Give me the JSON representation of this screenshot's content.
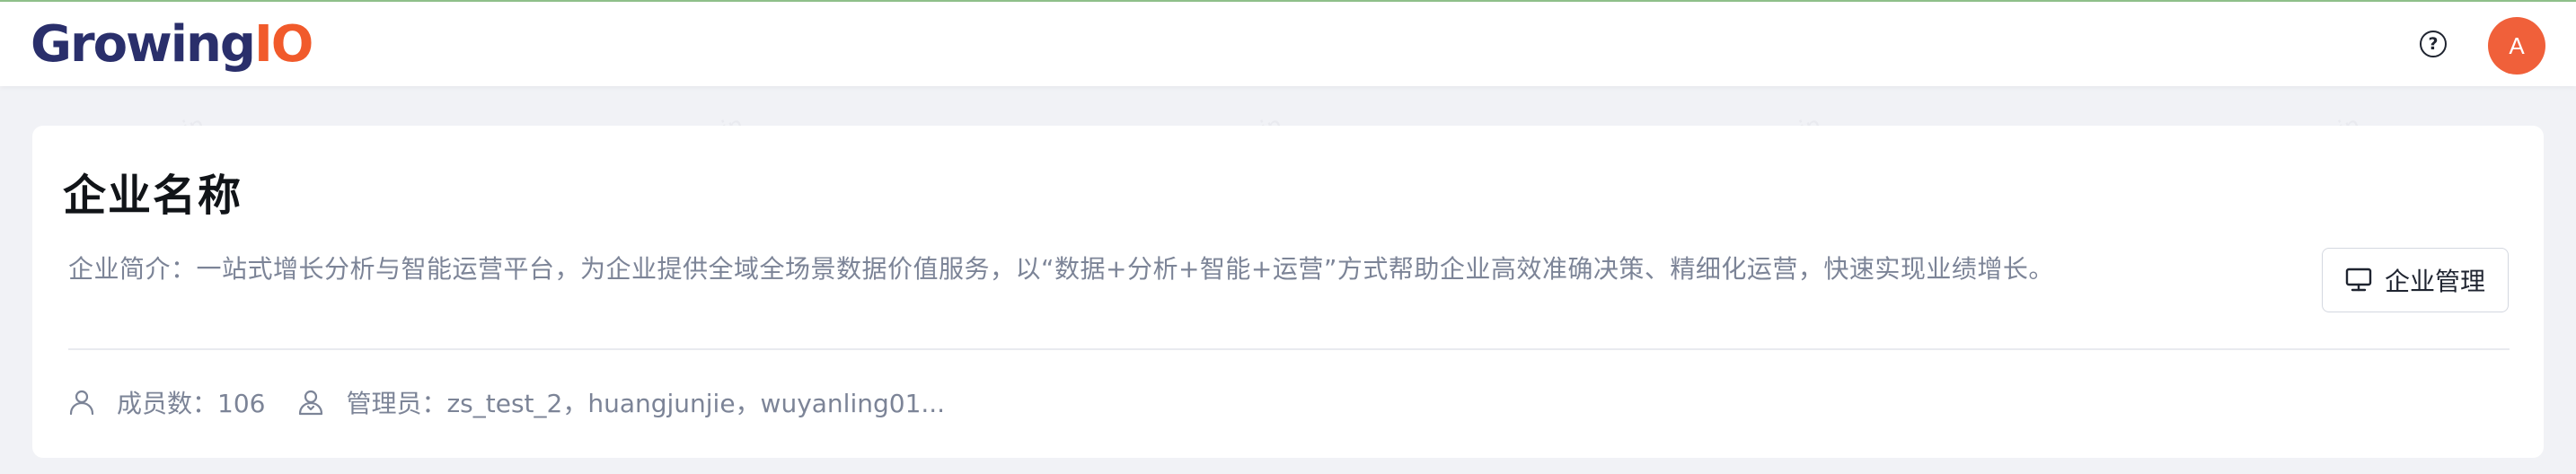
{
  "header": {
    "logo_main": "Growing",
    "logo_accent": "IO",
    "help_icon": "?",
    "avatar_initial": "A"
  },
  "watermark": "admin admin",
  "company": {
    "name": "企业名称",
    "description": "企业简介：一站式增长分析与智能运营平台，为企业提供全域全场景数据价值服务，以“数据+分析+智能+运营”方式帮助企业高效准确决策、精细化运营，快速实现业绩增长。",
    "manage_button_label": "企业管理",
    "members": "成员数：106",
    "admins": "管理员：zs_test_2，huangjunjie，wuyanling01..."
  },
  "icons": {
    "help": "question-circle-icon",
    "manage": "monitor-icon",
    "members": "user-icon",
    "admins": "admin-user-icon"
  },
  "colors": {
    "logo_main": "#2a2f6b",
    "logo_accent": "#f15a2b",
    "avatar_bg": "#f0603a",
    "secondary_text": "#7c8497"
  }
}
